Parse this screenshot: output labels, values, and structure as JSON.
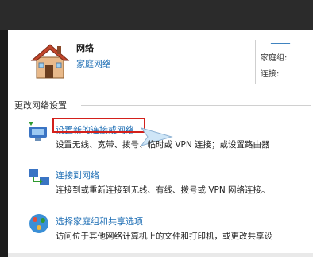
{
  "network": {
    "title": "网络",
    "subtitle": "家庭网络",
    "homegroup_label": "家庭组:",
    "connection_label": "连接:",
    "top_link": "────"
  },
  "section": {
    "label": "更改网络设置"
  },
  "items": [
    {
      "title": "设置新的连接或网络",
      "desc": "设置无线、宽带、拨号、临时或 VPN 连接；或设置路由器"
    },
    {
      "title": "连接到网络",
      "desc": "连接到或重新连接到无线、有线、拨号或 VPN 网络连接。"
    },
    {
      "title": "选择家庭组和共享选项",
      "desc": "访问位于其他网络计算机上的文件和打印机，或更改共享设"
    }
  ],
  "colors": {
    "link": "#1f6fb5",
    "highlight": "#d3201b"
  }
}
